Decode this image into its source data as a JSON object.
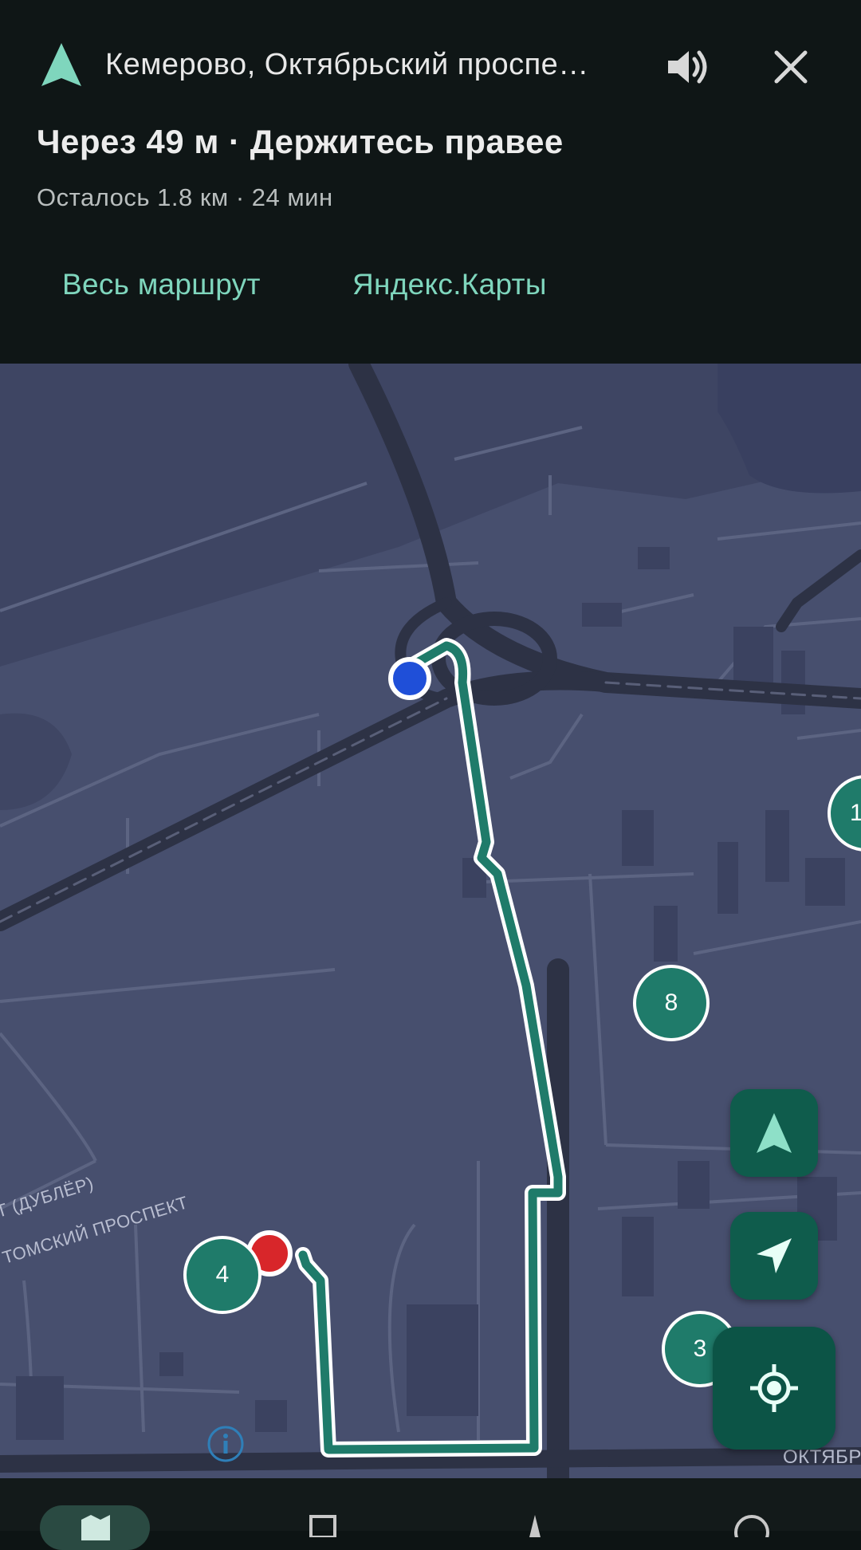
{
  "header": {
    "destination": "Кемерово, Октябрьский проспе…",
    "instruction": "Через 49 м · Держитесь правее",
    "remaining": "Осталось 1.8 км · 24 мин",
    "route_button": "Весь маршрут",
    "app_button": "Яндекс.Карты",
    "icons": {
      "nav": "navigation-arrow-icon",
      "sound": "volume-icon",
      "close": "close-icon"
    }
  },
  "map": {
    "street_labels": [
      "Т (ДУБЛЁР)",
      "ТОМСКИЙ ПРОСПЕКТ",
      "ОКТЯБР"
    ],
    "clusters": [
      "8",
      "4",
      "3",
      "1"
    ],
    "buttons": {
      "north": "compass-north-icon",
      "direction": "direction-arrow-icon",
      "locate": "my-location-icon",
      "info": "info-icon"
    }
  },
  "bottom_nav": {
    "tabs": [
      "map-tab-icon",
      "bookmarks-tab-icon",
      "navigation-tab-icon",
      "profile-tab-icon"
    ]
  },
  "colors": {
    "accent": "#7fd6bd",
    "route": "#1f7b6a",
    "map_bg": "#474f6e",
    "panel_bg": "#0f1616",
    "user_location": "#1f4fd8",
    "destination": "#d8262a"
  }
}
